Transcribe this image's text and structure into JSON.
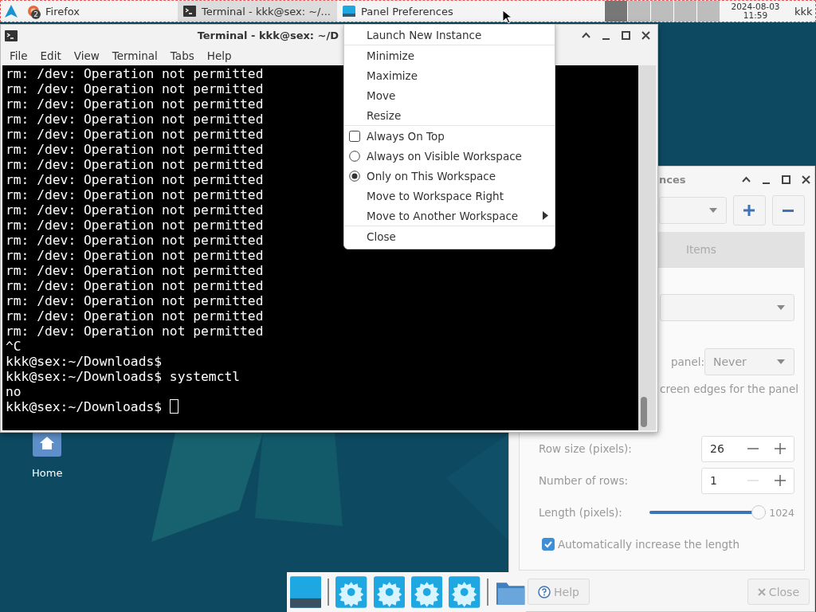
{
  "top_panel": {
    "tasks": [
      {
        "kind": "browser",
        "label": "Firefox",
        "badge": "2",
        "selected": false
      },
      {
        "kind": "terminal",
        "label": "Terminal - kkk@sex: ~/...",
        "selected": true
      },
      {
        "kind": "panel",
        "label": "Panel Preferences",
        "selected": false
      }
    ],
    "clock": {
      "date": "2024-08-03",
      "time": "11:59"
    },
    "user": "kkk"
  },
  "desktop_icons": [
    {
      "label": "Home"
    }
  ],
  "terminal": {
    "title": "Terminal - kkk@sex: ~/D",
    "menu": [
      "File",
      "Edit",
      "View",
      "Terminal",
      "Tabs",
      "Help"
    ],
    "lines": [
      "rm: /dev: Operation not permitted",
      "rm: /dev: Operation not permitted",
      "rm: /dev: Operation not permitted",
      "rm: /dev: Operation not permitted",
      "rm: /dev: Operation not permitted",
      "rm: /dev: Operation not permitted",
      "rm: /dev: Operation not permitted",
      "rm: /dev: Operation not permitted",
      "rm: /dev: Operation not permitted",
      "rm: /dev: Operation not permitted",
      "rm: /dev: Operation not permitted",
      "rm: /dev: Operation not permitted",
      "rm: /dev: Operation not permitted",
      "rm: /dev: Operation not permitted",
      "rm: /dev: Operation not permitted",
      "rm: /dev: Operation not permitted",
      "rm: /dev: Operation not permitted",
      "rm: /dev: Operation not permitted",
      "^C",
      "kkk@sex:~/Downloads$",
      "kkk@sex:~/Downloads$ systemctl",
      "no",
      "kkk@sex:~/Downloads$ "
    ]
  },
  "panel_preferences": {
    "title": "nces",
    "tab": {
      "label": "Items",
      "selected": false
    },
    "autohide_label": "panel:",
    "autohide_value": "Never",
    "edges_text": "creen edges for the panel",
    "row_size": {
      "label": "Row size (pixels):",
      "value": "26"
    },
    "rows": {
      "label": "Number of rows:",
      "value": "1"
    },
    "length": {
      "label": "Length (pixels):",
      "level": 1.0,
      "reading": "1024"
    },
    "auto_increase": {
      "label": "Automatically increase the length",
      "checked": true
    },
    "buttons": [
      "Help",
      "Close"
    ]
  },
  "context_menu": {
    "sections": [
      [
        {
          "kind": "action",
          "label": "Launch New Instance"
        }
      ],
      [
        {
          "kind": "action",
          "label": "Minimize"
        },
        {
          "kind": "action",
          "label": "Maximize"
        },
        {
          "kind": "action",
          "label": "Move"
        },
        {
          "kind": "action",
          "label": "Resize"
        }
      ],
      [
        {
          "kind": "check",
          "label": "Always On Top",
          "checked": false
        },
        {
          "kind": "radio",
          "label": "Always on Visible Workspace",
          "selected": false
        },
        {
          "kind": "radio",
          "label": "Only on This Workspace",
          "selected": true
        },
        {
          "kind": "action",
          "label": "Move to Workspace Right"
        },
        {
          "kind": "submenu",
          "label": "Move to Another Workspace"
        }
      ],
      [
        {
          "kind": "action",
          "label": "Close"
        }
      ]
    ]
  },
  "dock": {
    "items": [
      {
        "kind": "panel"
      },
      {
        "kind": "gear"
      },
      {
        "kind": "gear"
      },
      {
        "kind": "gear"
      },
      {
        "kind": "gear"
      },
      {
        "kind": "folder"
      }
    ]
  }
}
